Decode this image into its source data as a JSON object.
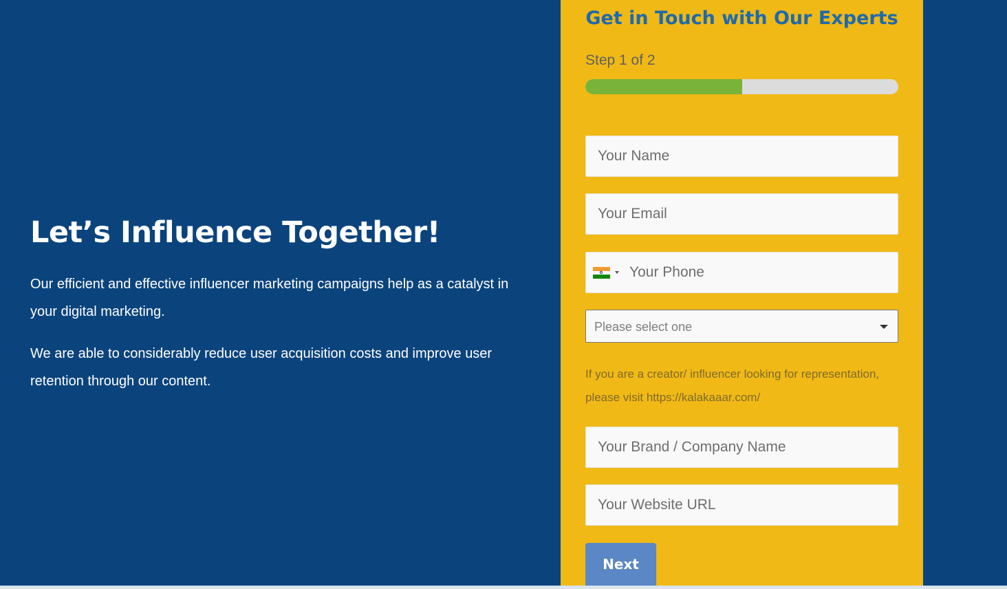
{
  "hero": {
    "title": "Let’s Influence Together!",
    "paragraph1": "Our efficient and effective influencer marketing campaigns help as a catalyst in your digital marketing.",
    "paragraph2": "We are able to considerably reduce user acquisition costs and improve user retention through our content."
  },
  "form": {
    "title": "Get in Touch with Our Experts",
    "step_label": "Step 1 of 2",
    "progress_fraction": 0.5,
    "name_placeholder": "Your Name",
    "email_placeholder": "Your Email",
    "phone_placeholder": "Your Phone",
    "phone_country_icon": "india-flag-icon",
    "select_value": "Please select one",
    "help_text": "If you are a creator/ influencer looking for representation, please visit https://kalakaaar.com/",
    "brand_placeholder": "Your Brand / Company Name",
    "url_placeholder": "Your Website URL",
    "next_label": "Next"
  },
  "colors": {
    "background_blue": "#0b447d",
    "form_yellow": "#f0b915",
    "title_blue": "#1f6aac",
    "progress_green": "#7ab33a",
    "progress_track": "#dcdcdc",
    "button_blue": "#5b87c7"
  }
}
